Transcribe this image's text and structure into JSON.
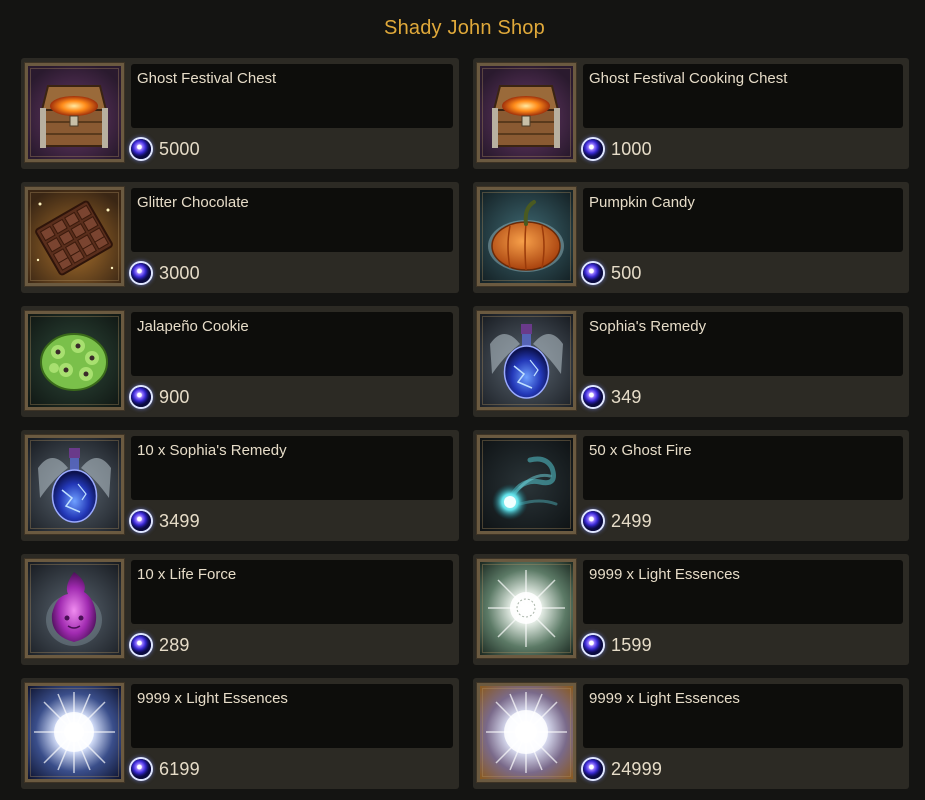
{
  "shop": {
    "title": "Shady John Shop",
    "currency_icon": "spirit-orb-icon",
    "items": [
      {
        "name": "Ghost Festival Chest",
        "price": "5000",
        "icon": "treasure-chest-icon"
      },
      {
        "name": "Ghost Festival Cooking Chest",
        "price": "1000",
        "icon": "treasure-chest-icon"
      },
      {
        "name": "Glitter Chocolate",
        "price": "3000",
        "icon": "chocolate-bar-icon"
      },
      {
        "name": "Pumpkin Candy",
        "price": "500",
        "icon": "pumpkin-icon"
      },
      {
        "name": "Jalapeño Cookie",
        "price": "900",
        "icon": "cookie-icon"
      },
      {
        "name": "Sophia's Remedy",
        "price": "349",
        "icon": "potion-icon"
      },
      {
        "name": "10 x Sophia's Remedy",
        "price": "3499",
        "icon": "potion-icon"
      },
      {
        "name": "50 x Ghost Fire",
        "price": "2499",
        "icon": "ghost-fire-icon"
      },
      {
        "name": "10 x Life Force",
        "price": "289",
        "icon": "life-force-flame-icon"
      },
      {
        "name": "9999 x Light Essences",
        "price": "1599",
        "icon": "light-essence-icon"
      },
      {
        "name": "9999 x Light Essences",
        "price": "6199",
        "icon": "light-essence-icon"
      },
      {
        "name": "9999 x Light Essences",
        "price": "24999",
        "icon": "light-essence-icon"
      }
    ]
  }
}
